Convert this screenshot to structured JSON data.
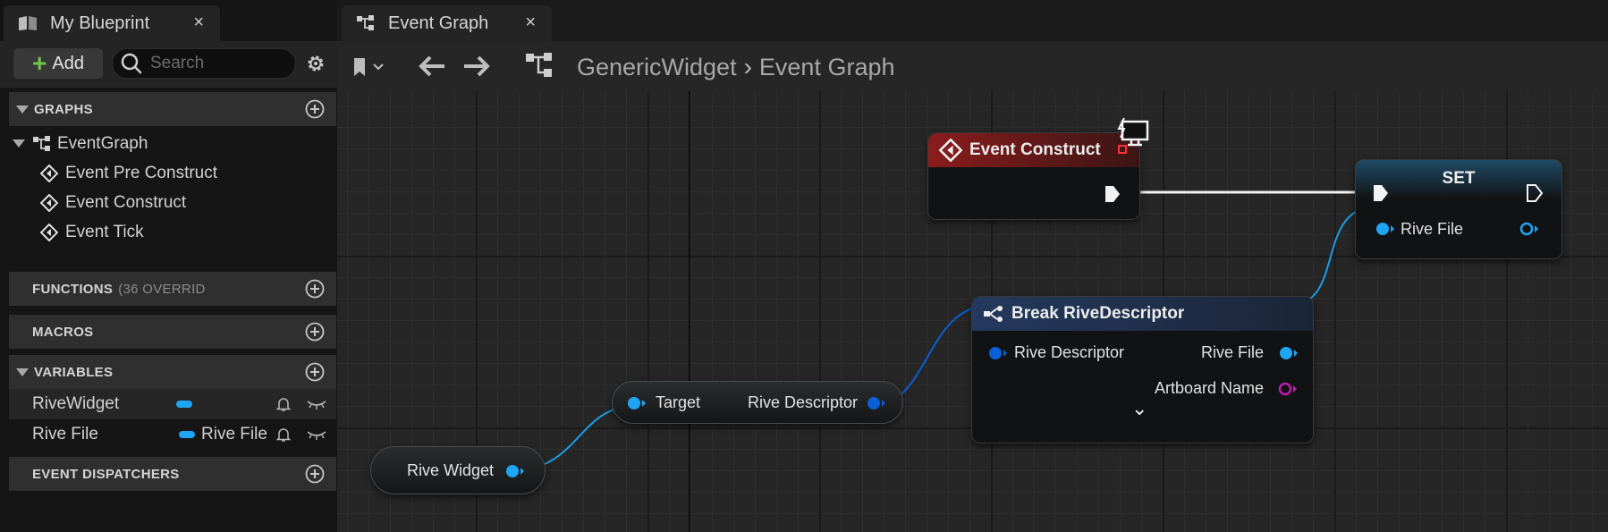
{
  "left_panel": {
    "tab_title": "My Blueprint",
    "tab_close": "×",
    "add_label": "Add",
    "search_placeholder": "Search",
    "sections": {
      "graphs": {
        "label": "GRAPHS"
      },
      "functions": {
        "label": "FUNCTIONS",
        "sub": "(36 OVERRID"
      },
      "macros": {
        "label": "MACROS"
      },
      "variables": {
        "label": "VARIABLES"
      },
      "event_dispatchers": {
        "label": "EVENT DISPATCHERS"
      }
    },
    "graph_tree": {
      "root": "EventGraph",
      "events": [
        "Event Pre Construct",
        "Event Construct",
        "Event Tick"
      ]
    },
    "variables": [
      {
        "name": "RiveWidget",
        "type": ""
      },
      {
        "name": "Rive File",
        "type": "Rive File"
      }
    ]
  },
  "graph_panel": {
    "tab_title": "Event Graph",
    "tab_close": "×",
    "breadcrumb": [
      "GenericWidget",
      "Event Graph"
    ],
    "breadcrumb_sep": "›"
  },
  "nodes": {
    "event_construct": {
      "title": "Event Construct"
    },
    "set": {
      "title": "SET",
      "pin": "Rive File"
    },
    "break": {
      "title": "Break RiveDescriptor",
      "in_pin": "Rive Descriptor",
      "out_pins": [
        "Rive File",
        "Artboard Name"
      ],
      "expand": "⌄"
    },
    "get_descriptor": {
      "in_pin": "Target",
      "out_pin": "Rive Descriptor"
    },
    "rive_widget": {
      "label": "Rive Widget"
    }
  },
  "colors": {
    "object_pin": "#1ea6f5",
    "struct_pin": "#0a5fd6",
    "name_pin": "#c01ab0",
    "event_header": "#8a1c1c",
    "set_header": "#1f4a66",
    "break_header": "#24395e",
    "add_plus": "#6fc64a"
  }
}
